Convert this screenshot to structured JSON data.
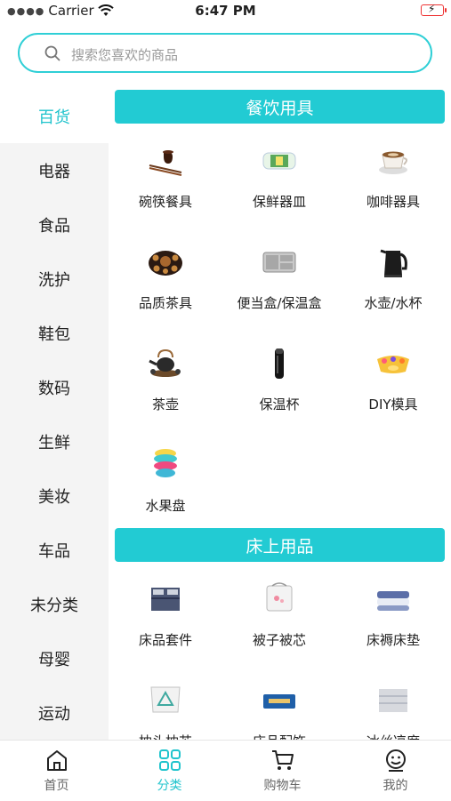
{
  "status_bar": {
    "carrier": "Carrier",
    "time": "6:47 PM"
  },
  "search": {
    "placeholder": "搜索您喜欢的商品"
  },
  "sidebar": {
    "active_index": 0,
    "items": [
      {
        "label": "百货"
      },
      {
        "label": "电器"
      },
      {
        "label": "食品"
      },
      {
        "label": "洗护"
      },
      {
        "label": "鞋包"
      },
      {
        "label": "数码"
      },
      {
        "label": "生鲜"
      },
      {
        "label": "美妆"
      },
      {
        "label": "车品"
      },
      {
        "label": "未分类"
      },
      {
        "label": "母婴"
      },
      {
        "label": "运动"
      }
    ]
  },
  "sections": [
    {
      "title": "餐饮用具",
      "items": [
        {
          "label": "碗筷餐具",
          "icon": "bowl-chopsticks-icon"
        },
        {
          "label": "保鲜器皿",
          "icon": "food-container-icon"
        },
        {
          "label": "咖啡器具",
          "icon": "coffee-cup-icon"
        },
        {
          "label": "品质茶具",
          "icon": "tea-set-icon"
        },
        {
          "label": "便当盒/保温盒",
          "icon": "lunch-box-icon"
        },
        {
          "label": "水壶/水杯",
          "icon": "kettle-icon"
        },
        {
          "label": "茶壶",
          "icon": "teapot-icon"
        },
        {
          "label": "保温杯",
          "icon": "thermos-icon"
        },
        {
          "label": "DIY模具",
          "icon": "mold-icon"
        },
        {
          "label": "水果盘",
          "icon": "fruit-plate-icon"
        }
      ]
    },
    {
      "title": "床上用品",
      "items": [
        {
          "label": "床品套件",
          "icon": "bedding-set-icon"
        },
        {
          "label": "被子被芯",
          "icon": "quilt-icon"
        },
        {
          "label": "床褥床垫",
          "icon": "mattress-icon"
        },
        {
          "label": "枕头枕芯",
          "icon": "pillow-icon"
        },
        {
          "label": "床品配饰",
          "icon": "bed-accessory-icon"
        },
        {
          "label": "冰丝凉席",
          "icon": "summer-mat-icon"
        }
      ]
    }
  ],
  "tabbar": {
    "active_index": 1,
    "items": [
      {
        "label": "首页",
        "icon": "home-icon"
      },
      {
        "label": "分类",
        "icon": "category-icon"
      },
      {
        "label": "购物车",
        "icon": "cart-icon"
      },
      {
        "label": "我的",
        "icon": "profile-icon"
      }
    ]
  },
  "colors": {
    "accent": "#22cbd3",
    "sidebar_bg": "#f4f4f4",
    "battery": "#e33333"
  }
}
